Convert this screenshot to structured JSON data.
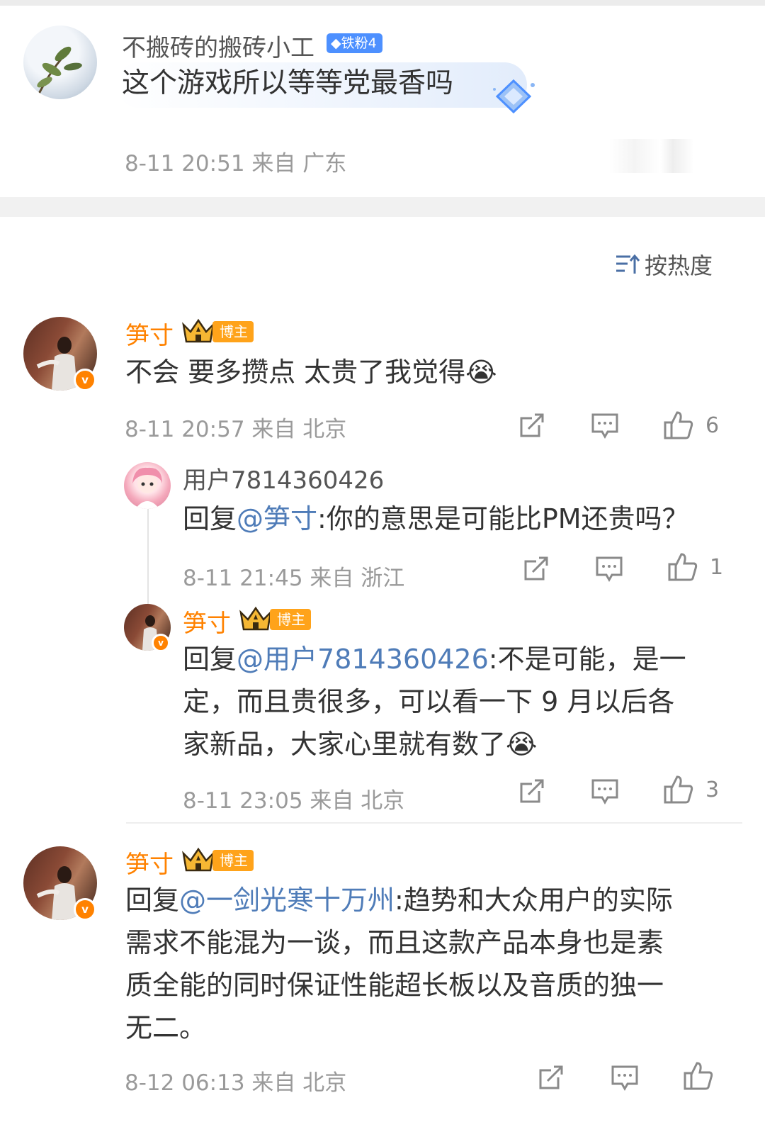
{
  "post": {
    "username": "不搬砖的搬砖小工",
    "fan_badge": "铁粉4",
    "text": "这个游戏所以等等党最香吗",
    "meta": "8-11 20:51 来自 广东"
  },
  "sort": {
    "label": "按热度"
  },
  "comments": [
    {
      "username": "笋寸",
      "role_badge": "博主",
      "text": "不会 要多攒点 太贵了我觉得😭",
      "meta": "8-11 20:57 来自 北京",
      "likes": "6"
    },
    {
      "username": "用户7814360426",
      "reply_prefix": "回复",
      "mention": "@笋寸",
      "text": ":你的意思是可能比PM还贵吗？",
      "meta": "8-11 21:45 来自 浙江",
      "likes": "1"
    },
    {
      "username": "笋寸",
      "role_badge": "博主",
      "reply_prefix": "回复",
      "mention": "@用户7814360426",
      "text_line1": ":不是可能，是一",
      "text_line2": "定，而且贵很多，可以看一下 9 月以后各",
      "text_line3": "家新品，大家心里就有数了😭",
      "meta": "8-11 23:05 来自 北京",
      "likes": "3"
    },
    {
      "username": "笋寸",
      "role_badge": "博主",
      "reply_prefix": "回复",
      "mention": "@一剑光寒十万州",
      "text_line1": ":趋势和大众用户的实际",
      "text_line2": "需求不能混为一谈，而且这款产品本身也是素",
      "text_line3": "质全能的同时保证性能超长板以及音质的独一",
      "text_line4": "无二。",
      "meta": "8-12 06:13 来自 北京"
    }
  ],
  "colors": {
    "accent_orange": "#ff8200",
    "mention_blue": "#4f7cb8",
    "fan_badge_blue": "#4d90ff"
  }
}
